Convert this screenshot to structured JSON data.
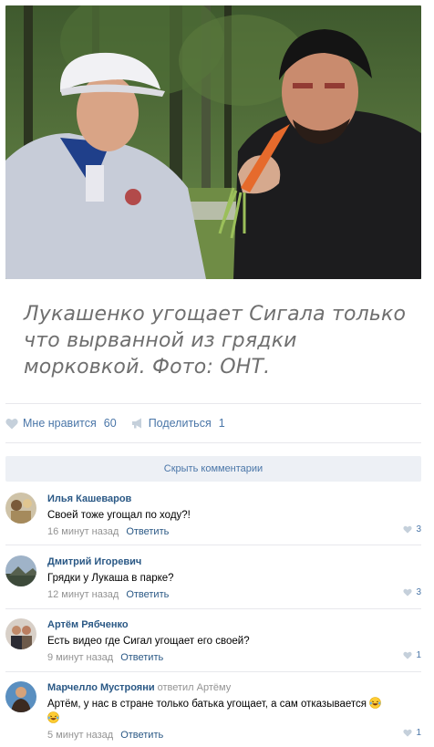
{
  "post": {
    "caption": "Лукашенко угощает Сигала только что вырванной из грядки морковкой. Фото: ОНТ.",
    "like_label": "Мне нравится",
    "like_count": "60",
    "share_label": "Поделиться",
    "share_count": "1"
  },
  "comments_header": {
    "hide_label": "Скрыть комментарии"
  },
  "comments": [
    {
      "author": "Илья Кашеваров",
      "text": "Своей тоже угощал по ходу?!",
      "time": "16 минут назад",
      "reply_label": "Ответить",
      "likes": "3"
    },
    {
      "author": "Дмитрий Игоревич",
      "text": "Грядки у Лукаша в парке?",
      "time": "12 минут назад",
      "reply_label": "Ответить",
      "likes": "3"
    },
    {
      "author": "Артём Рябченко",
      "text": "Есть видео где Сигал угощает его своей?",
      "time": "9 минут назад",
      "reply_label": "Ответить",
      "likes": "1"
    },
    {
      "author": "Марчелло Мустрояни",
      "replied_label": "ответил",
      "replied_to": "Артёму",
      "text": "Артём, у нас в стране только батька угощает, а сам отказывается",
      "time": "5 минут назад",
      "reply_label": "Ответить",
      "likes": "1",
      "emoji": "laughing-crying-emoji"
    }
  ],
  "colors": {
    "link": "#2a5885",
    "accent": "#4a76a8",
    "muted": "#939393",
    "caption": "#6f6f6f",
    "bar": "#edf0f5"
  }
}
